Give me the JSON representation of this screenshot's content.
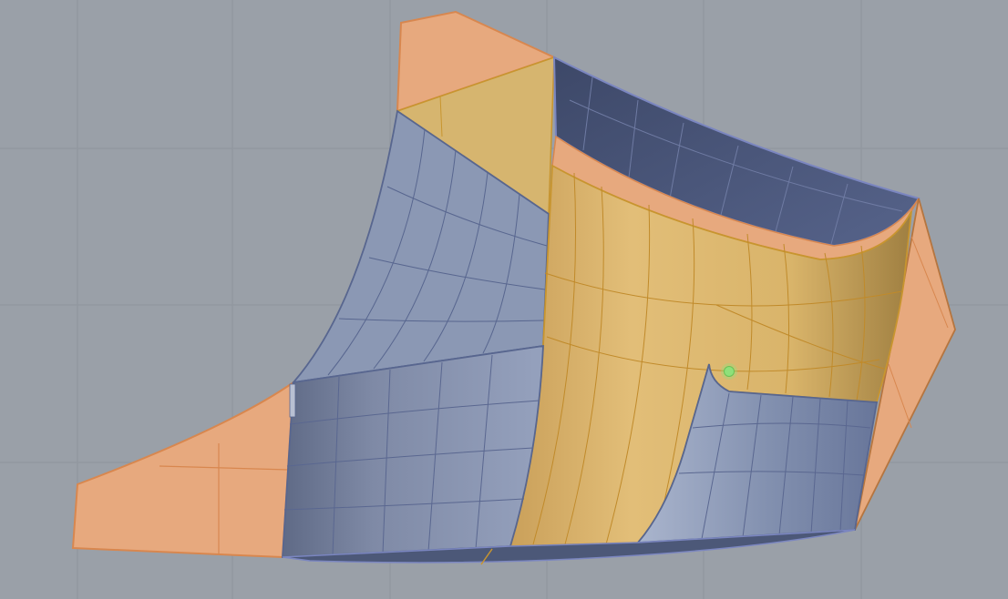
{
  "colors": {
    "background": "#9aa0a8",
    "grid": "#8f959d",
    "orange_face": "#e7a97e",
    "orange_edge": "#d8874f",
    "yellow_face": "#d9b46a",
    "yellow_edge": "#c8952f",
    "blue_face": "#8b98b4",
    "blue_dark": "#4c5878",
    "blue_edge": "#58668f",
    "selection_point": "#8fe07a"
  },
  "icons": {
    "control_point": "green-dot-icon"
  }
}
